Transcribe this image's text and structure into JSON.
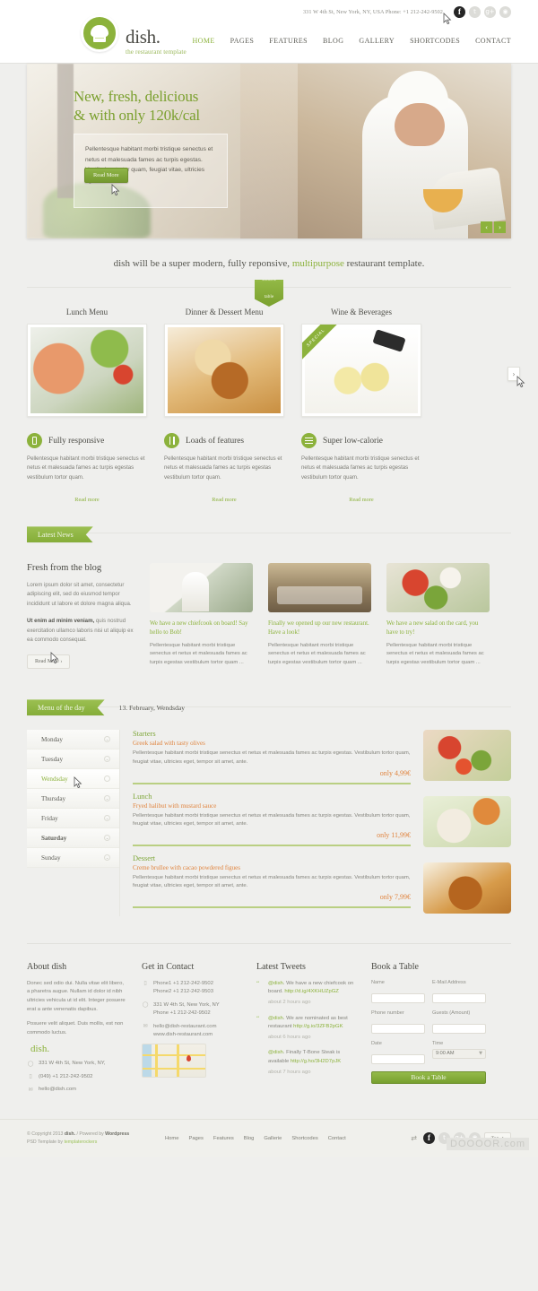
{
  "topbar": {
    "address_phone": "331 W 4th St, New York, NY, USA   Phone: +1 212-242-9502",
    "social": [
      "facebook-icon",
      "twitter-icon",
      "google-plus-icon",
      "rss-icon"
    ]
  },
  "header": {
    "brand_name": "dish.",
    "brand_tagline": "the restaurant template",
    "nav": [
      {
        "label": "HOME",
        "active": true
      },
      {
        "label": "PAGES",
        "active": false
      },
      {
        "label": "FEATURES",
        "active": false
      },
      {
        "label": "BLOG",
        "active": false
      },
      {
        "label": "GALLERY",
        "active": false
      },
      {
        "label": "SHORTCODES",
        "active": false
      },
      {
        "label": "CONTACT",
        "active": false
      }
    ]
  },
  "hero": {
    "title_line1": "New, fresh, delicious",
    "title_line2": "& with only 120k/cal",
    "body": "Pellentesque habitant morbi tristique senectus et netus et malesuada fames ac turpis egestas. Vestibulum tortor quam, feugiat vitae, ultricies eget.",
    "button": "Read More",
    "prev": "‹",
    "next": "›"
  },
  "tagline": {
    "before": "dish will be a super modern, fully reponsive, ",
    "accent": "multipurpose",
    "after": " restaurant template."
  },
  "book_badge": {
    "line1": "Book a",
    "line2": "table"
  },
  "cards": [
    {
      "title": "Lunch Menu",
      "photo": "salmon-salad-photo",
      "ribbon": ""
    },
    {
      "title": "Dinner & Dessert Menu",
      "photo": "creme-brulee-photo",
      "ribbon": ""
    },
    {
      "title": "Wine & Beverages",
      "photo": "white-wine-photo",
      "ribbon": "SPECIAL"
    }
  ],
  "cards_next": "›",
  "features": [
    {
      "icon": "mobile-icon",
      "title": "Fully responsive",
      "body": "Pellentesque habitant morbi tristique senectus et netus et malesuada fames ac turpis egestas vestibulum tortor quam.",
      "link": "Read more"
    },
    {
      "icon": "utensils-icon",
      "title": "Loads of features",
      "body": "Pellentesque habitant morbi tristique senectus et netus et malesuada fames ac turpis egestas vestibulum tortor quam.",
      "link": "Read more"
    },
    {
      "icon": "list-icon",
      "title": "Super low-calorie",
      "body": "Pellentesque habitant morbi tristique senectus et netus et malesuada fames ac turpis egestas vestibulum tortor quam.",
      "link": "Read more"
    }
  ],
  "latest_news": {
    "section_title": "Latest News",
    "intro_title": "Fresh from the blog",
    "intro_p1": "Lorem ipsum dolor sit amet, consectetur adipiscing elit, sed do eiusmod tempor incididunt ut labore et dolore magna aliqua.",
    "intro_p2_bold": "Ut enim ad minim veniam,",
    "intro_p2_rest": " quis nostrud exercitation ullamco laboris nisi ut aliquip ex ea commodo consequat.",
    "button": "Read More ›",
    "posts": [
      {
        "title": "We have a new chiefcook on board! Say hello to Bob!",
        "text": "Pellentesque habitant morbi tristique senectus et netus et malesuada fames ac turpis egestas vestibulum tortor quam ..."
      },
      {
        "title": "Finally we opened up our new restaurant. Have a look!",
        "text": "Pellentesque habitant morbi tristique senectus et netus et malesuada fames ac turpis egestas vestibulum tortor quam ..."
      },
      {
        "title": "We have a new salad on the card, you have to try!",
        "text": "Pellentesque habitant morbi tristique senectus et netus et malesuada fames ac turpis egestas vestibulum tortor quam ..."
      }
    ]
  },
  "menu_of_day": {
    "section_title": "Menu of the day",
    "date": "13. February, Wendsday",
    "days": [
      {
        "label": "Monday",
        "active": false,
        "bold": false
      },
      {
        "label": "Tuesday",
        "active": false,
        "bold": false
      },
      {
        "label": "Wendsday",
        "active": true,
        "bold": false
      },
      {
        "label": "Thursday",
        "active": false,
        "bold": false
      },
      {
        "label": "Friday",
        "active": false,
        "bold": false
      },
      {
        "label": "Saturday",
        "active": false,
        "bold": true
      },
      {
        "label": "Sunday",
        "active": false,
        "bold": false
      }
    ],
    "items": [
      {
        "category": "Starters",
        "name": "Greek salad with tasty olives",
        "desc": "Pellentesque habitant morbi tristique senectus et netus et malesuada fames ac turpis egestas. Vestibulum tortor quam, feugiat vitae, ultricies eget, tempor sit amet, ante.",
        "price": "only 4,99€",
        "photo": "greek-salad-photo"
      },
      {
        "category": "Lunch",
        "name": "Fryed halibut with mustard sauce",
        "desc": "Pellentesque habitant morbi tristique senectus et netus et malesuada fames ac turpis egestas. Vestibulum tortor quam, feugiat vitae, ultricies eget, tempor sit amet, ante.",
        "price": "only 11,99€",
        "photo": "halibut-photo"
      },
      {
        "category": "Dessert",
        "name": "Creme brullee with cacao powdered figues",
        "desc": "Pellentesque habitant morbi tristique senectus et netus et malesuada fames ac turpis egestas. Vestibulum tortor quam, feugiat vitae, ultricies eget, tempor sit amet, ante.",
        "price": "only 7,99€",
        "photo": "creme-brulee-photo"
      }
    ]
  },
  "footer": {
    "about": {
      "title": "About dish",
      "p1": "Donec sed odio dui. Nulla vitae elit libero, a pharetra augue. Nullam id dolor id nibh ultricies vehicula ut id elit. Integer posuere erat a ante venenatis dapibus.",
      "p2": "Posuere velit aliquet. Duis mollis, est non commodo luctus.",
      "brand": "dish.",
      "address": "331 W 4th St, New York, NY,",
      "phone": "(049)  +1 212-242-9502",
      "email": "hello@dish.com"
    },
    "contact": {
      "title": "Get in Contact",
      "phone1": "Phone1 +1 212-242-9502",
      "phone2": "Phone2 +1 212-242-9503",
      "addr1": "331 W 4th St, New York, NY",
      "addr2": "Phone +1 212-242-9502",
      "mail1": "hello@dish-restaurant.com",
      "mail2": "www.dish-restaurant.com"
    },
    "tweets": {
      "title": "Latest Tweets",
      "items": [
        {
          "handle": "@dish",
          "text": ". We have a new chiefcook on board. ",
          "link": "http://d.ig/4XKHUZpGZ",
          "time": "about 2 hours ago"
        },
        {
          "handle": "@dish",
          "text": ". We are nominated as best restaurant ",
          "link": "http://g.io/3ZFB2pGK",
          "time": "about 6 hours ago"
        },
        {
          "handle": "@dish",
          "text": ". Finally T-Bone Steak is available ",
          "link": "http://g.ho/3H2D7pJK",
          "time": "about 7 hours ago"
        }
      ]
    },
    "book": {
      "title": "Book a Table",
      "name_label": "Name",
      "name_value": "",
      "email_label": "E-Mail Address",
      "email_value": "",
      "phone_label": "Phone number",
      "phone_value": "",
      "guests_label": "Guests (Amount)",
      "guests_value": "",
      "date_label": "Date",
      "date_value": "",
      "time_label": "Time",
      "time_value": "9:00 AM",
      "submit": "Book a Table"
    }
  },
  "bottom": {
    "copyright_line1_a": "© Copyright 2013 ",
    "copyright_brand": "dish.",
    "copyright_line1_b": " / Powered by ",
    "copyright_wp": "Wordpress",
    "copyright_line2_a": "PSD Template by ",
    "copyright_line2_link": "templaterockers",
    "nav": [
      "Home",
      "Pages",
      "Features",
      "Blog",
      "Gallerie",
      "Shortcodes",
      "Contact"
    ],
    "top_label": "Top",
    "top_arrow": "↑",
    "shuffle_icon": "shuffle-icon"
  },
  "watermark": "DOOOOR.com",
  "colors": {
    "green": "#8cb23c",
    "orange": "#e0843f",
    "text": "#85857e",
    "heading": "#4a4a44"
  }
}
